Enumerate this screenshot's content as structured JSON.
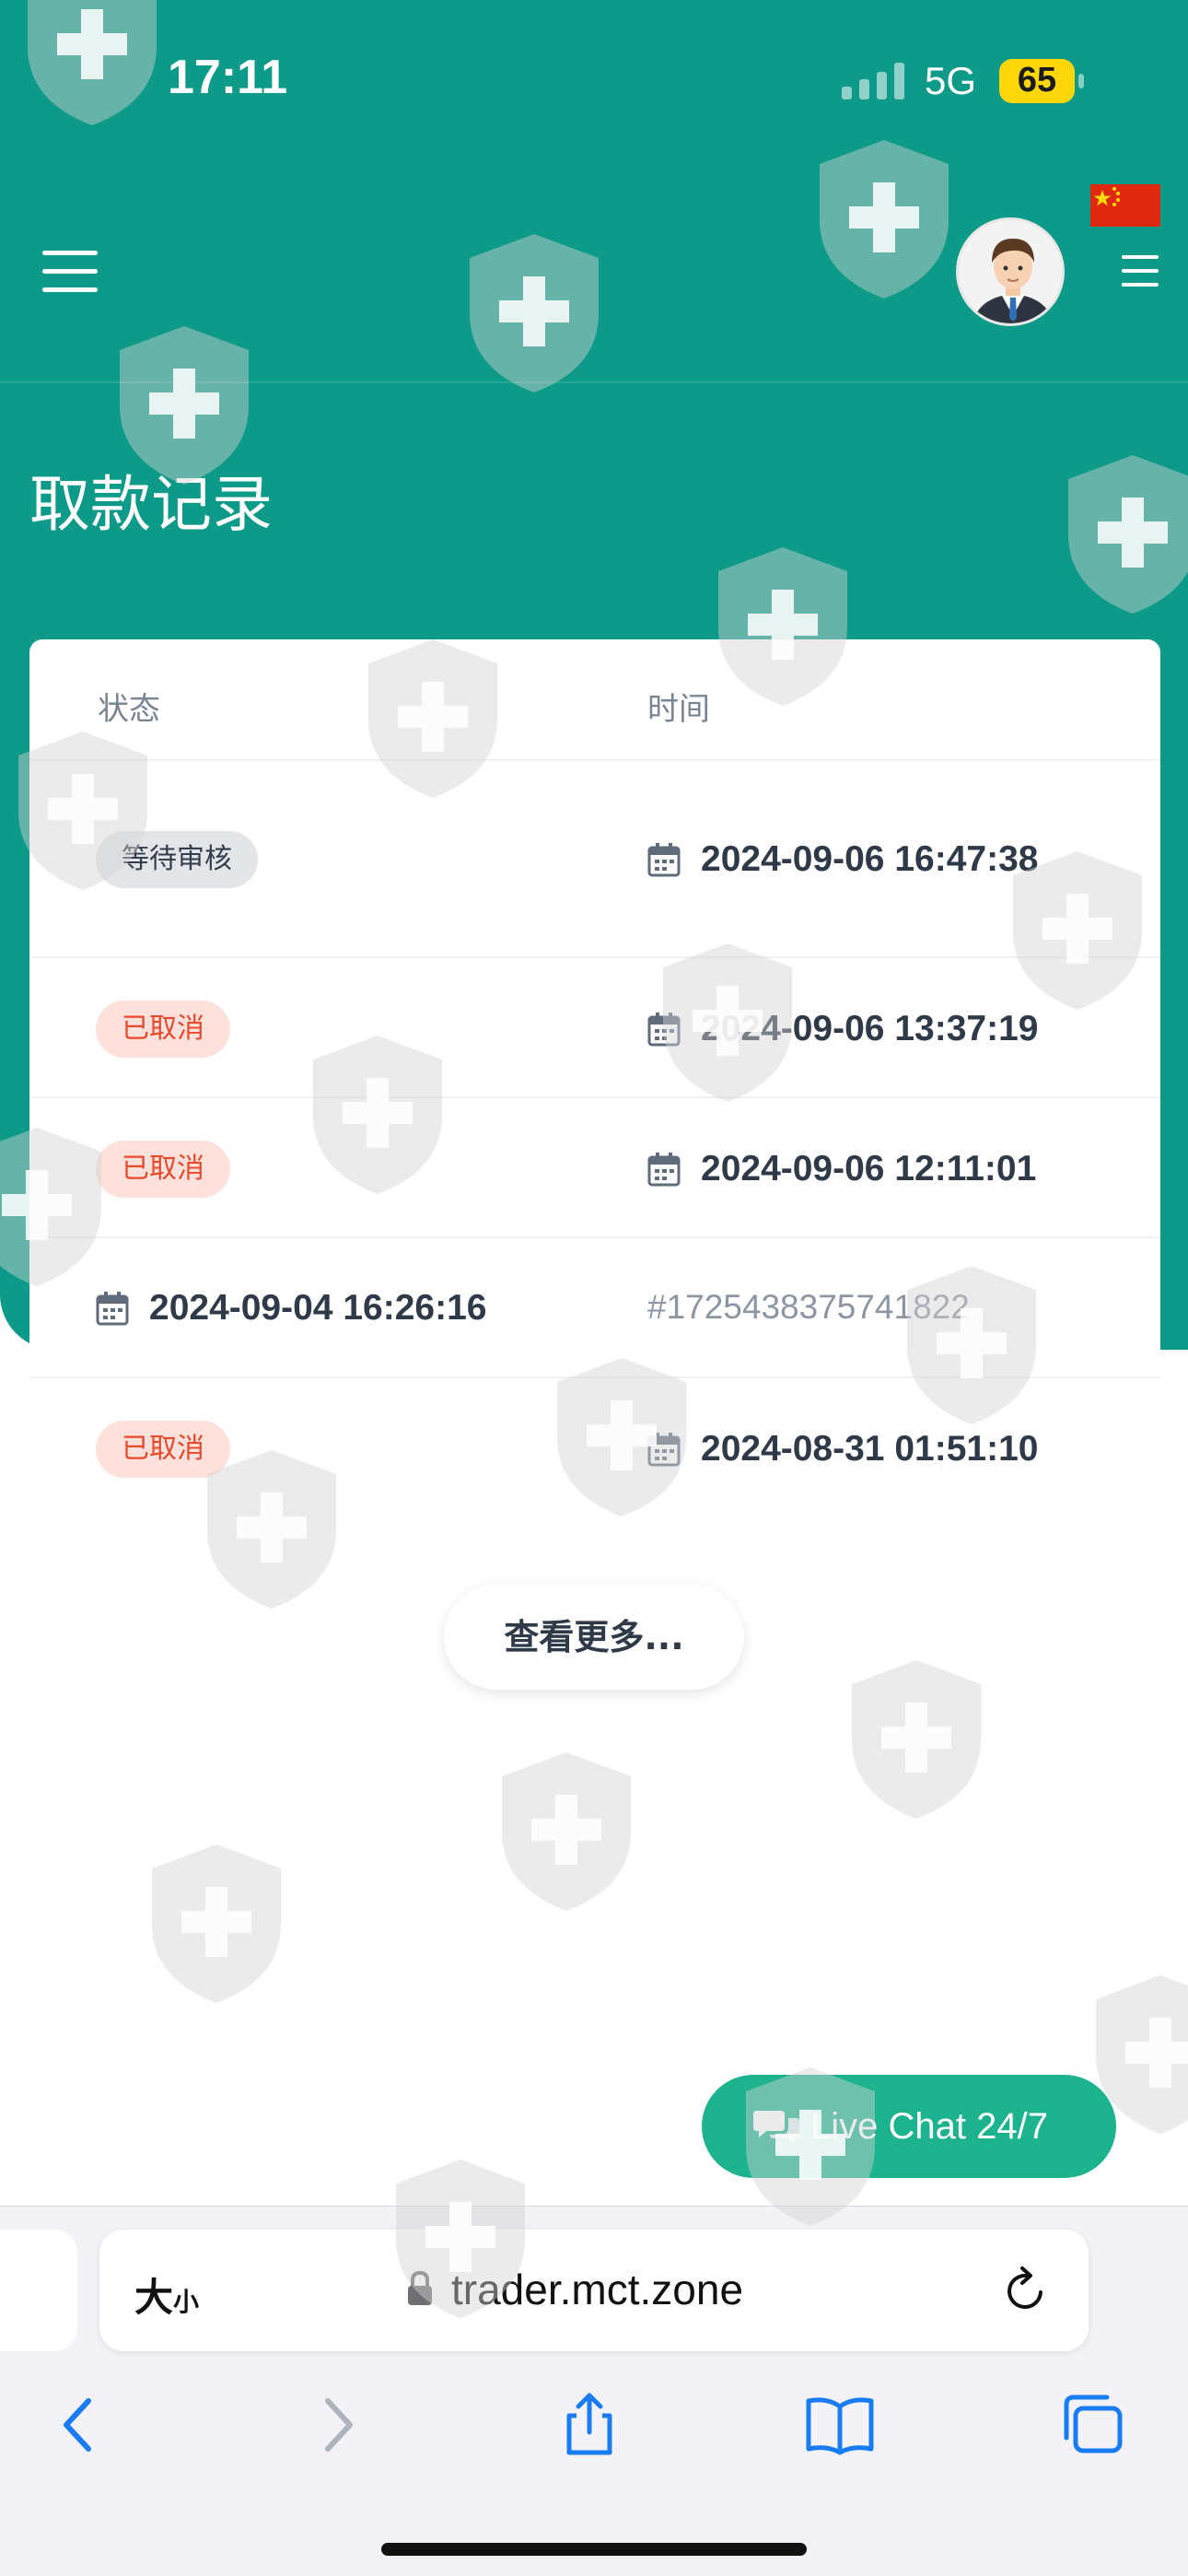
{
  "status_bar": {
    "time": "17:11",
    "network": "5G",
    "battery": "65"
  },
  "header": {
    "avatar": "user-avatar",
    "flag": "china-flag"
  },
  "page": {
    "title": "取款记录"
  },
  "table": {
    "headers": {
      "status": "状态",
      "time": "时间"
    },
    "rows": [
      {
        "status": "等待审核",
        "time": "2024-09-06 16:47:38"
      },
      {
        "status": "已取消",
        "time": "2024-09-06 13:37:19"
      },
      {
        "status": "已取消",
        "time": "2024-09-06 12:11:01"
      },
      {
        "time": "2024-09-04 16:26:16",
        "order_id": "#1725438375741822"
      },
      {
        "status": "已取消",
        "time": "2024-08-31 01:51:10"
      }
    ]
  },
  "load_more": "查看更多...",
  "live_chat": "Live Chat 24/7",
  "browser": {
    "text_size": "大",
    "text_size_small": "小",
    "url": "trader.mct.zone"
  },
  "colors": {
    "teal": "#0d9a88",
    "chat_green": "#1db38f",
    "cancel_red": "#e8492d",
    "pending_gray": "#e3e5e8"
  }
}
